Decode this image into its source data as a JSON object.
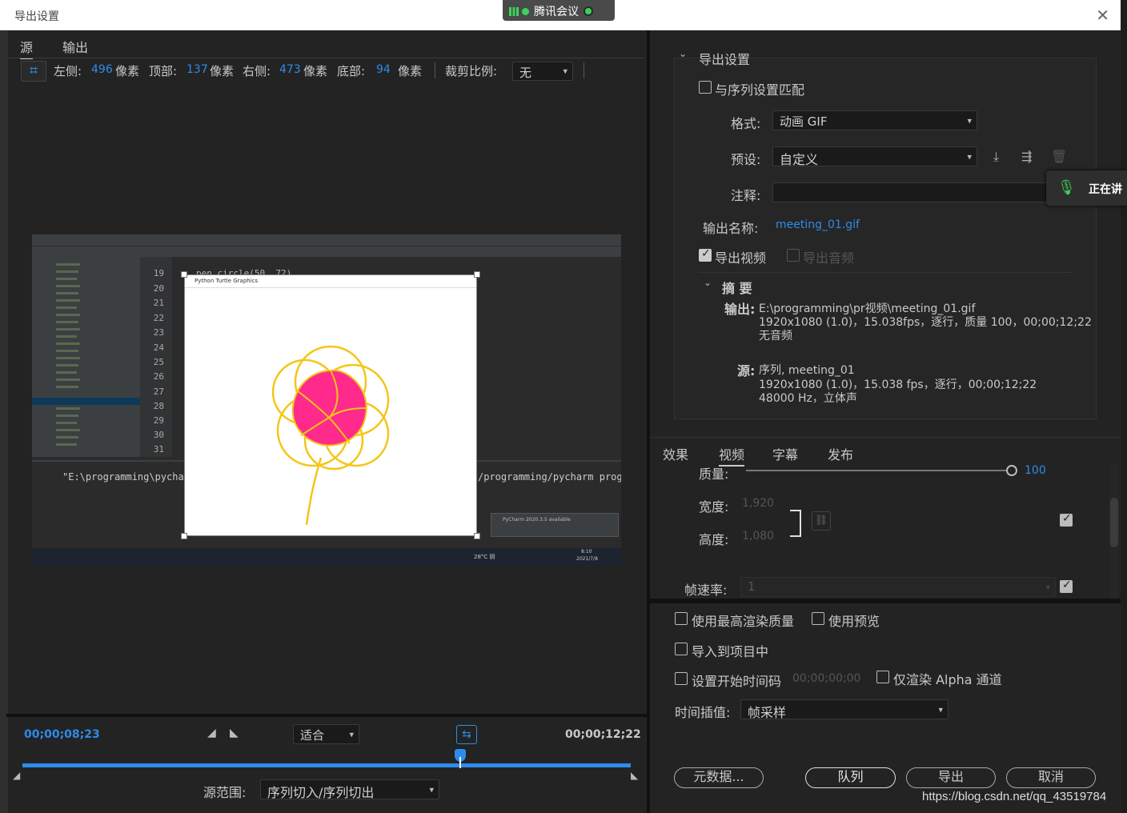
{
  "window": {
    "title": "导出设置",
    "close_glyph": "✕"
  },
  "meeting": {
    "label": "腾讯会议"
  },
  "source_tabs": [
    {
      "label": "源"
    },
    {
      "label": "输出"
    }
  ],
  "crop": {
    "left_label": "左侧:",
    "left_value": "496",
    "unit": "像素",
    "top_label": "顶部:",
    "top_value": "137",
    "right_label": "右侧:",
    "right_value": "473",
    "bottom_label": "底部:",
    "bottom_value": "94",
    "ratio_label": "裁剪比例:",
    "ratio_value": "无"
  },
  "preview": {
    "line_numbers": [
      "19",
      "20",
      "21",
      "22",
      "23",
      "24",
      "25",
      "26",
      "27",
      "28",
      "29",
      "30",
      "31"
    ],
    "code_top": "pen.circle(50, 72)",
    "turtle_title": "Python Turtle Graphics",
    "run_text_left": "\"E:\\programming\\pychar",
    "run_text_right": "/programming/pycharm progr",
    "notice": "PyCharm 2020.3.5 available",
    "weather": "28°C 阴",
    "clock_time": "8:10",
    "clock_date": "2021/7/8"
  },
  "timeline": {
    "current_tc": "00;00;08;23",
    "end_tc": "00;00;12;22",
    "fit_value": "适合",
    "source_range_label": "源范围:",
    "source_range_value": "序列切入/序列切出",
    "playhead_fraction": 0.72
  },
  "export": {
    "section_title": "导出设置",
    "match_sequence": "与序列设置匹配",
    "format_label": "格式:",
    "format_value": "动画 GIF",
    "preset_label": "预设:",
    "preset_value": "自定义",
    "comment_label": "注释:",
    "output_name_label": "输出名称:",
    "output_name_value": "meeting_01.gif",
    "export_video": "导出视频",
    "export_audio": "导出音频",
    "summary_title": "摘 要",
    "summary_output_label": "输出:",
    "summary_output_lines": [
      "E:\\programming\\pr视频\\meeting_01.gif",
      "1920x1080 (1.0)，15.038fps，逐行，质量 100，00;00;12;22",
      "无音频"
    ],
    "summary_source_label": "源:",
    "summary_source_lines": [
      "序列, meeting_01",
      "1920x1080 (1.0)，15.038 fps，逐行，00;00;12;22",
      "48000 Hz，立体声"
    ]
  },
  "mic_popup": {
    "text": "正在讲"
  },
  "settings_tabs": [
    {
      "label": "效果"
    },
    {
      "label": "视频"
    },
    {
      "label": "字幕"
    },
    {
      "label": "发布"
    }
  ],
  "video": {
    "quality_label": "质量:",
    "quality_value": "100",
    "quality_fraction": 1.0,
    "width_label": "宽度:",
    "width_value": "1,920",
    "height_label": "高度:",
    "height_value": "1,080",
    "framerate_label": "帧速率:",
    "framerate_value": "1"
  },
  "options": {
    "max_render": "使用最高渲染质量",
    "use_preview": "使用预览",
    "import_project": "导入到项目中",
    "set_start_tc": "设置开始时间码",
    "start_tc_value": "00;00;00;00",
    "alpha_only": "仅渲染 Alpha 通道",
    "time_interp_label": "时间插值:",
    "time_interp_value": "帧采样"
  },
  "buttons": {
    "metadata": "元数据...",
    "queue": "队列",
    "export": "导出",
    "cancel": "取消"
  },
  "watermark": "https://blog.csdn.net/qq_43519784",
  "colors": {
    "accent": "#2d8ceb",
    "panel": "#232323",
    "flower_fill": "#ff2a8c",
    "flower_stroke": "#f5c518"
  }
}
